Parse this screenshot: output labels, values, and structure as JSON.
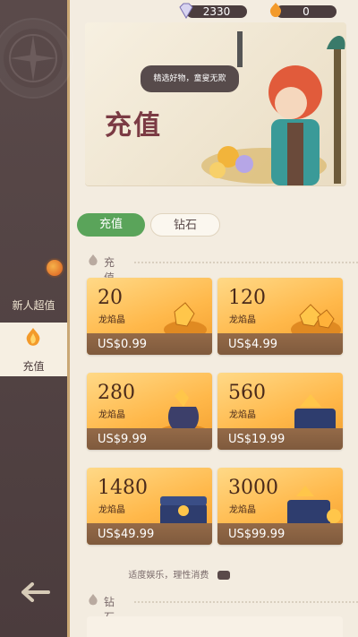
{
  "resources": {
    "diamond": "2330",
    "fire_crystal": "0"
  },
  "banner": {
    "title": "充值",
    "bubble": "精选好物，童叟无欺"
  },
  "sidebar": {
    "items": [
      {
        "label": "新人超值"
      },
      {
        "label": "充值"
      }
    ]
  },
  "tabs": [
    {
      "label": "充值",
      "active": true
    },
    {
      "label": "钻石",
      "active": false
    }
  ],
  "sections": {
    "recharge": "充值",
    "diamond": "钻石"
  },
  "products": [
    {
      "amount": "20",
      "unit": "龙焰晶",
      "price": "US$0.99"
    },
    {
      "amount": "120",
      "unit": "龙焰晶",
      "price": "US$4.99"
    },
    {
      "amount": "280",
      "unit": "龙焰晶",
      "price": "US$9.99"
    },
    {
      "amount": "560",
      "unit": "龙焰晶",
      "price": "US$19.99"
    },
    {
      "amount": "1480",
      "unit": "龙焰晶",
      "price": "US$49.99"
    },
    {
      "amount": "3000",
      "unit": "龙焰晶",
      "price": "US$99.99"
    }
  ],
  "footer_note": "适度娱乐，理性消费",
  "colors": {
    "sidebar": "#4b3c3d",
    "accent_green": "#5aa45a",
    "card_orange": "#ffb84a",
    "price_bar": "#7f5a3d"
  }
}
